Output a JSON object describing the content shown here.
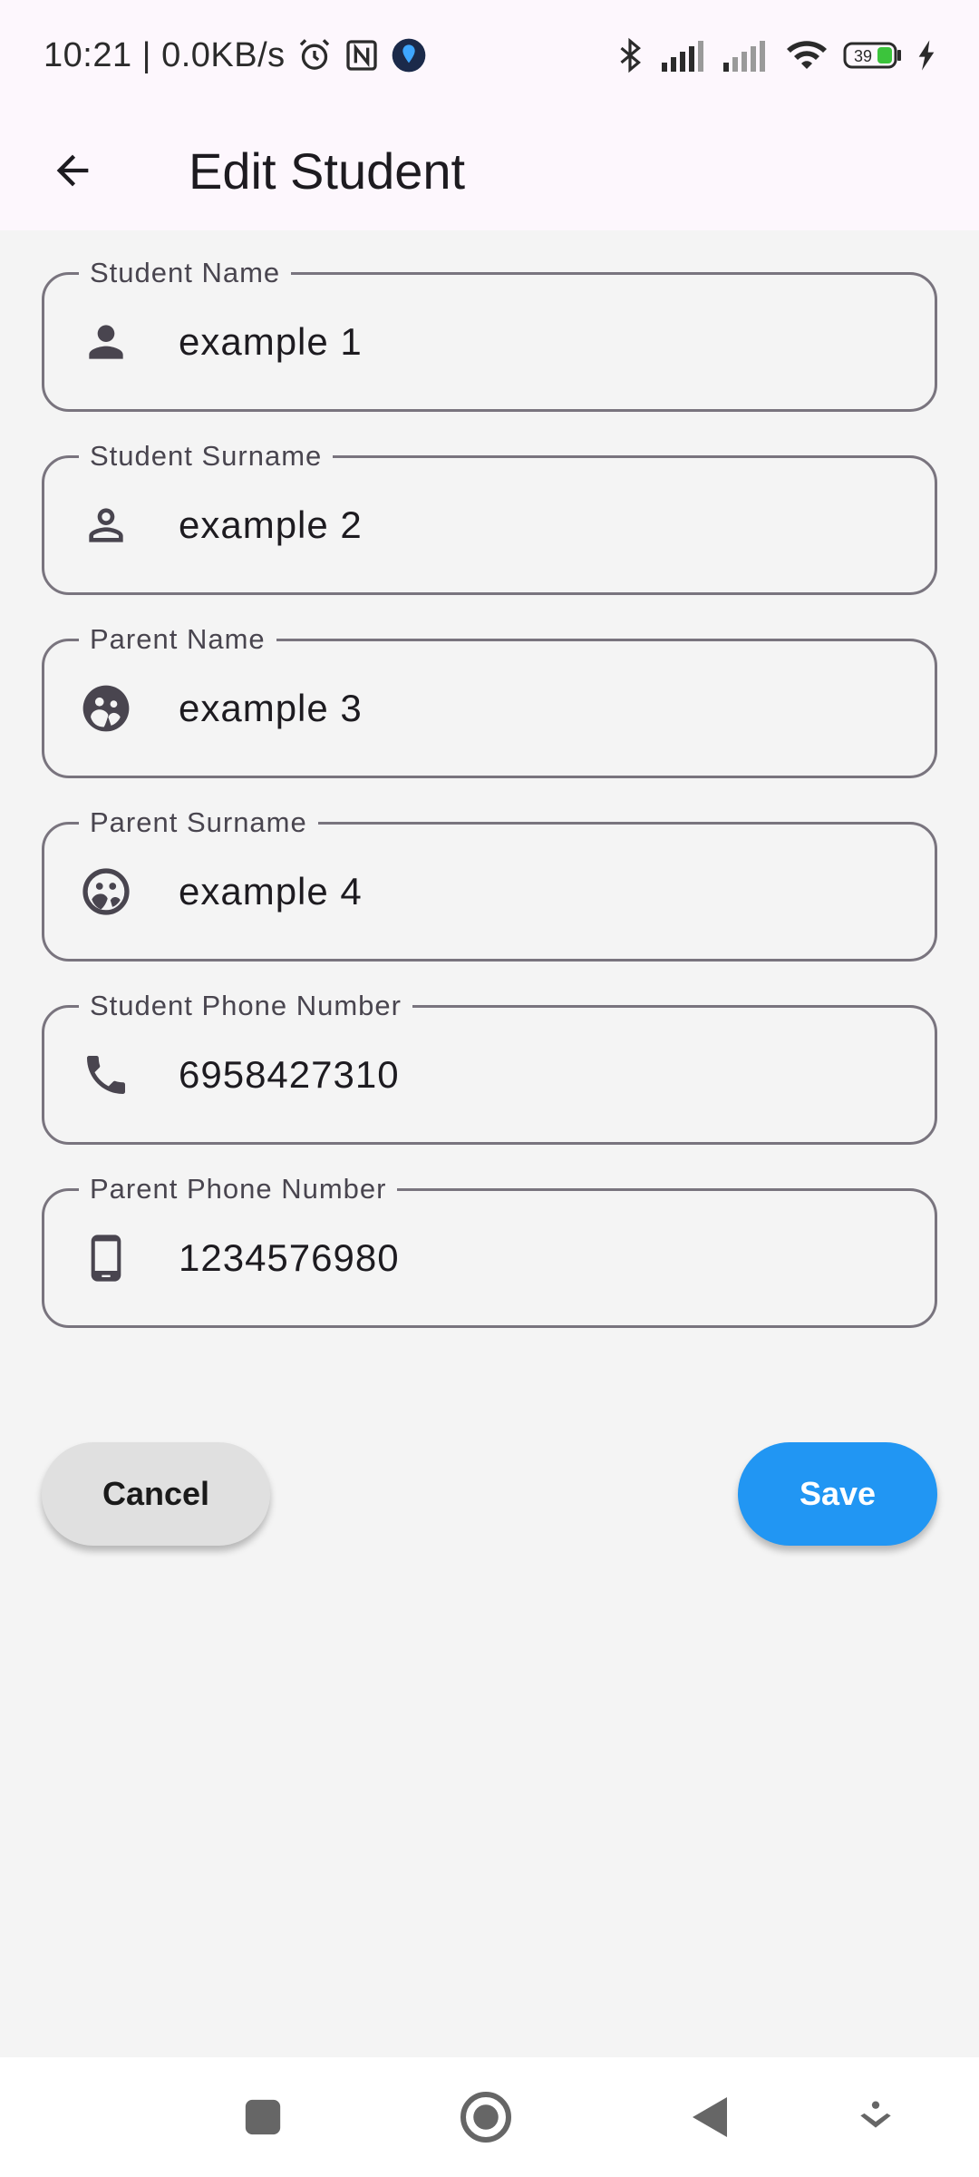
{
  "status_bar": {
    "time_speed": "10:21 | 0.0KB/s",
    "battery": "39",
    "icons": [
      "alarm-icon",
      "nfc-icon",
      "vpn-icon",
      "bluetooth-icon",
      "signal-icon",
      "signal-icon-2",
      "wifi-icon",
      "battery-icon",
      "charging-icon"
    ]
  },
  "app_bar": {
    "title": "Edit Student",
    "back_icon": "arrow-back-icon"
  },
  "form": {
    "fields": [
      {
        "label": "Student Name",
        "value": "example 1",
        "icon": "person-icon"
      },
      {
        "label": "Student Surname",
        "value": "example 2",
        "icon": "person-outline-icon"
      },
      {
        "label": "Parent Name",
        "value": "example 3",
        "icon": "family-face-icon"
      },
      {
        "label": "Parent Surname",
        "value": "example 4",
        "icon": "face-outline-icon"
      },
      {
        "label": "Student Phone Number",
        "value": "6958427310",
        "icon": "phone-icon"
      },
      {
        "label": "Parent Phone Number",
        "value": "1234576980",
        "icon": "smartphone-icon"
      }
    ]
  },
  "actions": {
    "cancel_label": "Cancel",
    "save_label": "Save"
  },
  "colors": {
    "accent": "#2196f3",
    "header_bg": "#fdf7fd",
    "page_bg": "#f4f4f4",
    "outline": "#79747e"
  },
  "nav_bar": {
    "icons": [
      "recents-icon",
      "home-icon",
      "back-icon",
      "assist-icon"
    ]
  }
}
